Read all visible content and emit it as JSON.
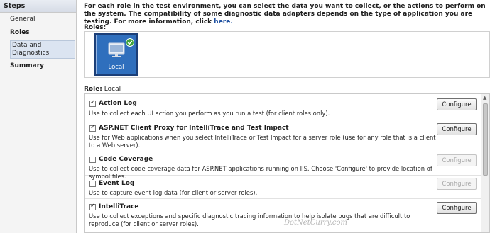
{
  "sidebar": {
    "header": "Steps",
    "items": [
      {
        "label": "General",
        "bold": false
      },
      {
        "label": "Roles",
        "bold": true
      },
      {
        "label": "Data and Diagnostics",
        "bold": false,
        "selected": true
      },
      {
        "label": "Summary",
        "bold": true
      }
    ]
  },
  "intro": {
    "text": "For each role in the test environment, you can select the data you want to collect, or the actions to perform on the system. The compatibility of some diagnostic data adapters depends on the type of application you are testing. For more information, click ",
    "link": "here."
  },
  "roles": {
    "label": "Roles:",
    "tile": {
      "caption": "Local",
      "icon": "computer-icon",
      "status_icon": "green-check-icon"
    }
  },
  "role_line": {
    "label": "Role:",
    "value": "Local"
  },
  "adapters": [
    {
      "name": "Action Log",
      "checked": true,
      "description": "Use to collect each UI action you perform as you run a test (for client roles only).",
      "button": "Configure",
      "button_enabled": true
    },
    {
      "name": "ASP.NET Client Proxy for IntelliTrace and Test Impact",
      "checked": true,
      "description": "Use for Web applications when you select IntelliTrace or Test Impact for a server role (use for any role that is a client to a Web server).",
      "button": "Configure",
      "button_enabled": true
    },
    {
      "name": "Code Coverage",
      "checked": false,
      "description": "Use to collect code coverage data for ASP.NET applications running on IIS. Choose 'Configure' to provide location of symbol files.",
      "button": "Configure",
      "button_enabled": false
    },
    {
      "name": "Event Log",
      "checked": false,
      "description": "Use to capture event log data (for client or server roles).",
      "button": "Configure",
      "button_enabled": false
    },
    {
      "name": "IntelliTrace",
      "checked": true,
      "description": "Use to collect exceptions and specific diagnostic tracing information to help isolate bugs that are difficult to reproduce (for client or server roles).",
      "button": "Configure",
      "button_enabled": true
    }
  ],
  "watermark": "DotNetCurry.com",
  "colors": {
    "tile_blue": "#2f6fbd",
    "link_blue": "#1e50a0",
    "selected_step": "#dbe4f1"
  }
}
